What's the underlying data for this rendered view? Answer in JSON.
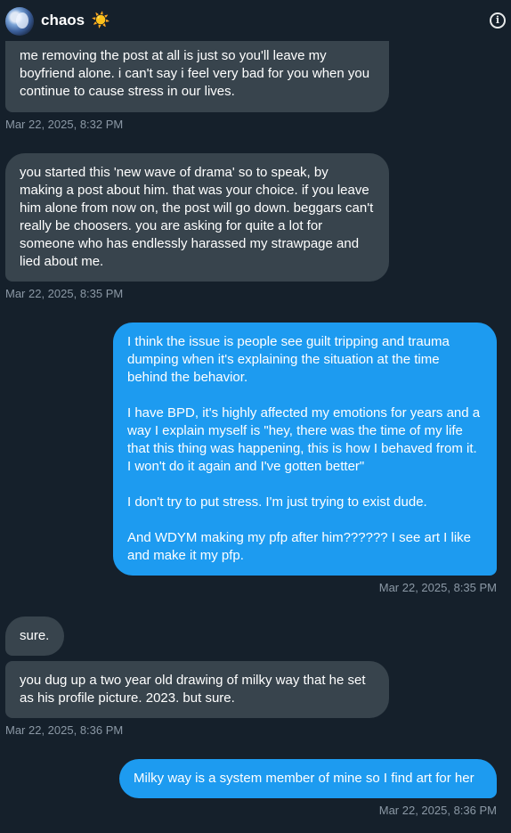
{
  "header": {
    "name": "chaos",
    "emoji": "☀️",
    "info_icon": "info-icon",
    "avatar": "avatar"
  },
  "messages": [
    {
      "direction": "in",
      "text": "me removing the post at all is just so you'll leave my boyfriend alone. i can't say i feel very bad for you when you continue to cause stress in our lives.",
      "timestamp": "Mar 22, 2025, 8:32 PM"
    },
    {
      "direction": "in",
      "text": "you started this 'new wave of drama' so to speak, by making a post about him. that was your choice. if you leave him alone from now on, the post will go down. beggars can't really be choosers. you are asking for quite a lot for someone who has endlessly harassed my strawpage and lied about me.",
      "timestamp": "Mar 22, 2025, 8:35 PM"
    },
    {
      "direction": "out",
      "text": "I think the issue is people see guilt tripping and trauma dumping when it's explaining the situation at the time behind the behavior.\n\nI have BPD, it's highly affected my emotions for years and a way I explain myself is \"hey, there was the time of my life that this thing was happening, this is how I behaved from it. I won't do it again and I've gotten better\"\n\nI don't try to put stress. I'm just trying to exist dude.\n\nAnd WDYM making my pfp after him?????? I see art I like and make it my pfp.",
      "timestamp": "Mar 22, 2025, 8:35 PM"
    },
    {
      "direction": "in",
      "text": "sure.",
      "timestamp": ""
    },
    {
      "direction": "in",
      "text": "you dug up a two year old drawing of milky way that he set as his profile picture. 2023. but sure.",
      "timestamp": "Mar 22, 2025, 8:36 PM"
    },
    {
      "direction": "out",
      "text": "Milky way is a system member of mine so I find art for her",
      "timestamp": "Mar 22, 2025, 8:36 PM"
    }
  ],
  "colors": {
    "background": "#15202b",
    "incoming_bubble": "#38444d",
    "outgoing_bubble": "#1d9bf0",
    "timestamp": "#8b98a5"
  }
}
